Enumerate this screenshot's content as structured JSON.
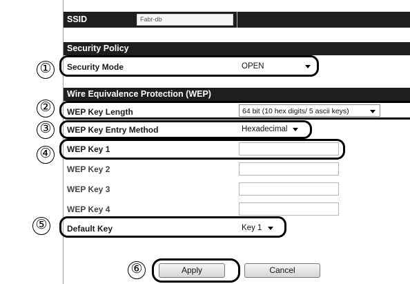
{
  "ssid": {
    "label": "SSID",
    "value": "Fabr-db"
  },
  "security_policy": {
    "header": "Security Policy",
    "security_mode": {
      "label": "Security Mode",
      "value": "OPEN"
    }
  },
  "wep": {
    "header": "Wire Equivalence Protection (WEP)",
    "key_length": {
      "label": "WEP Key Length",
      "value": "64 bit (10 hex digits/ 5 ascii keys)"
    },
    "entry_method": {
      "label": "WEP Key Entry Method",
      "value": "Hexadecimal"
    },
    "key1": {
      "label": "WEP Key 1",
      "value": ""
    },
    "key2": {
      "label": "WEP Key 2",
      "value": ""
    },
    "key3": {
      "label": "WEP Key 3",
      "value": ""
    },
    "key4": {
      "label": "WEP Key 4",
      "value": ""
    },
    "default_key": {
      "label": "Default Key",
      "value": "Key 1"
    }
  },
  "buttons": {
    "apply": "Apply",
    "cancel": "Cancel"
  },
  "callouts": [
    "①",
    "②",
    "③",
    "④",
    "⑤",
    "⑥"
  ]
}
